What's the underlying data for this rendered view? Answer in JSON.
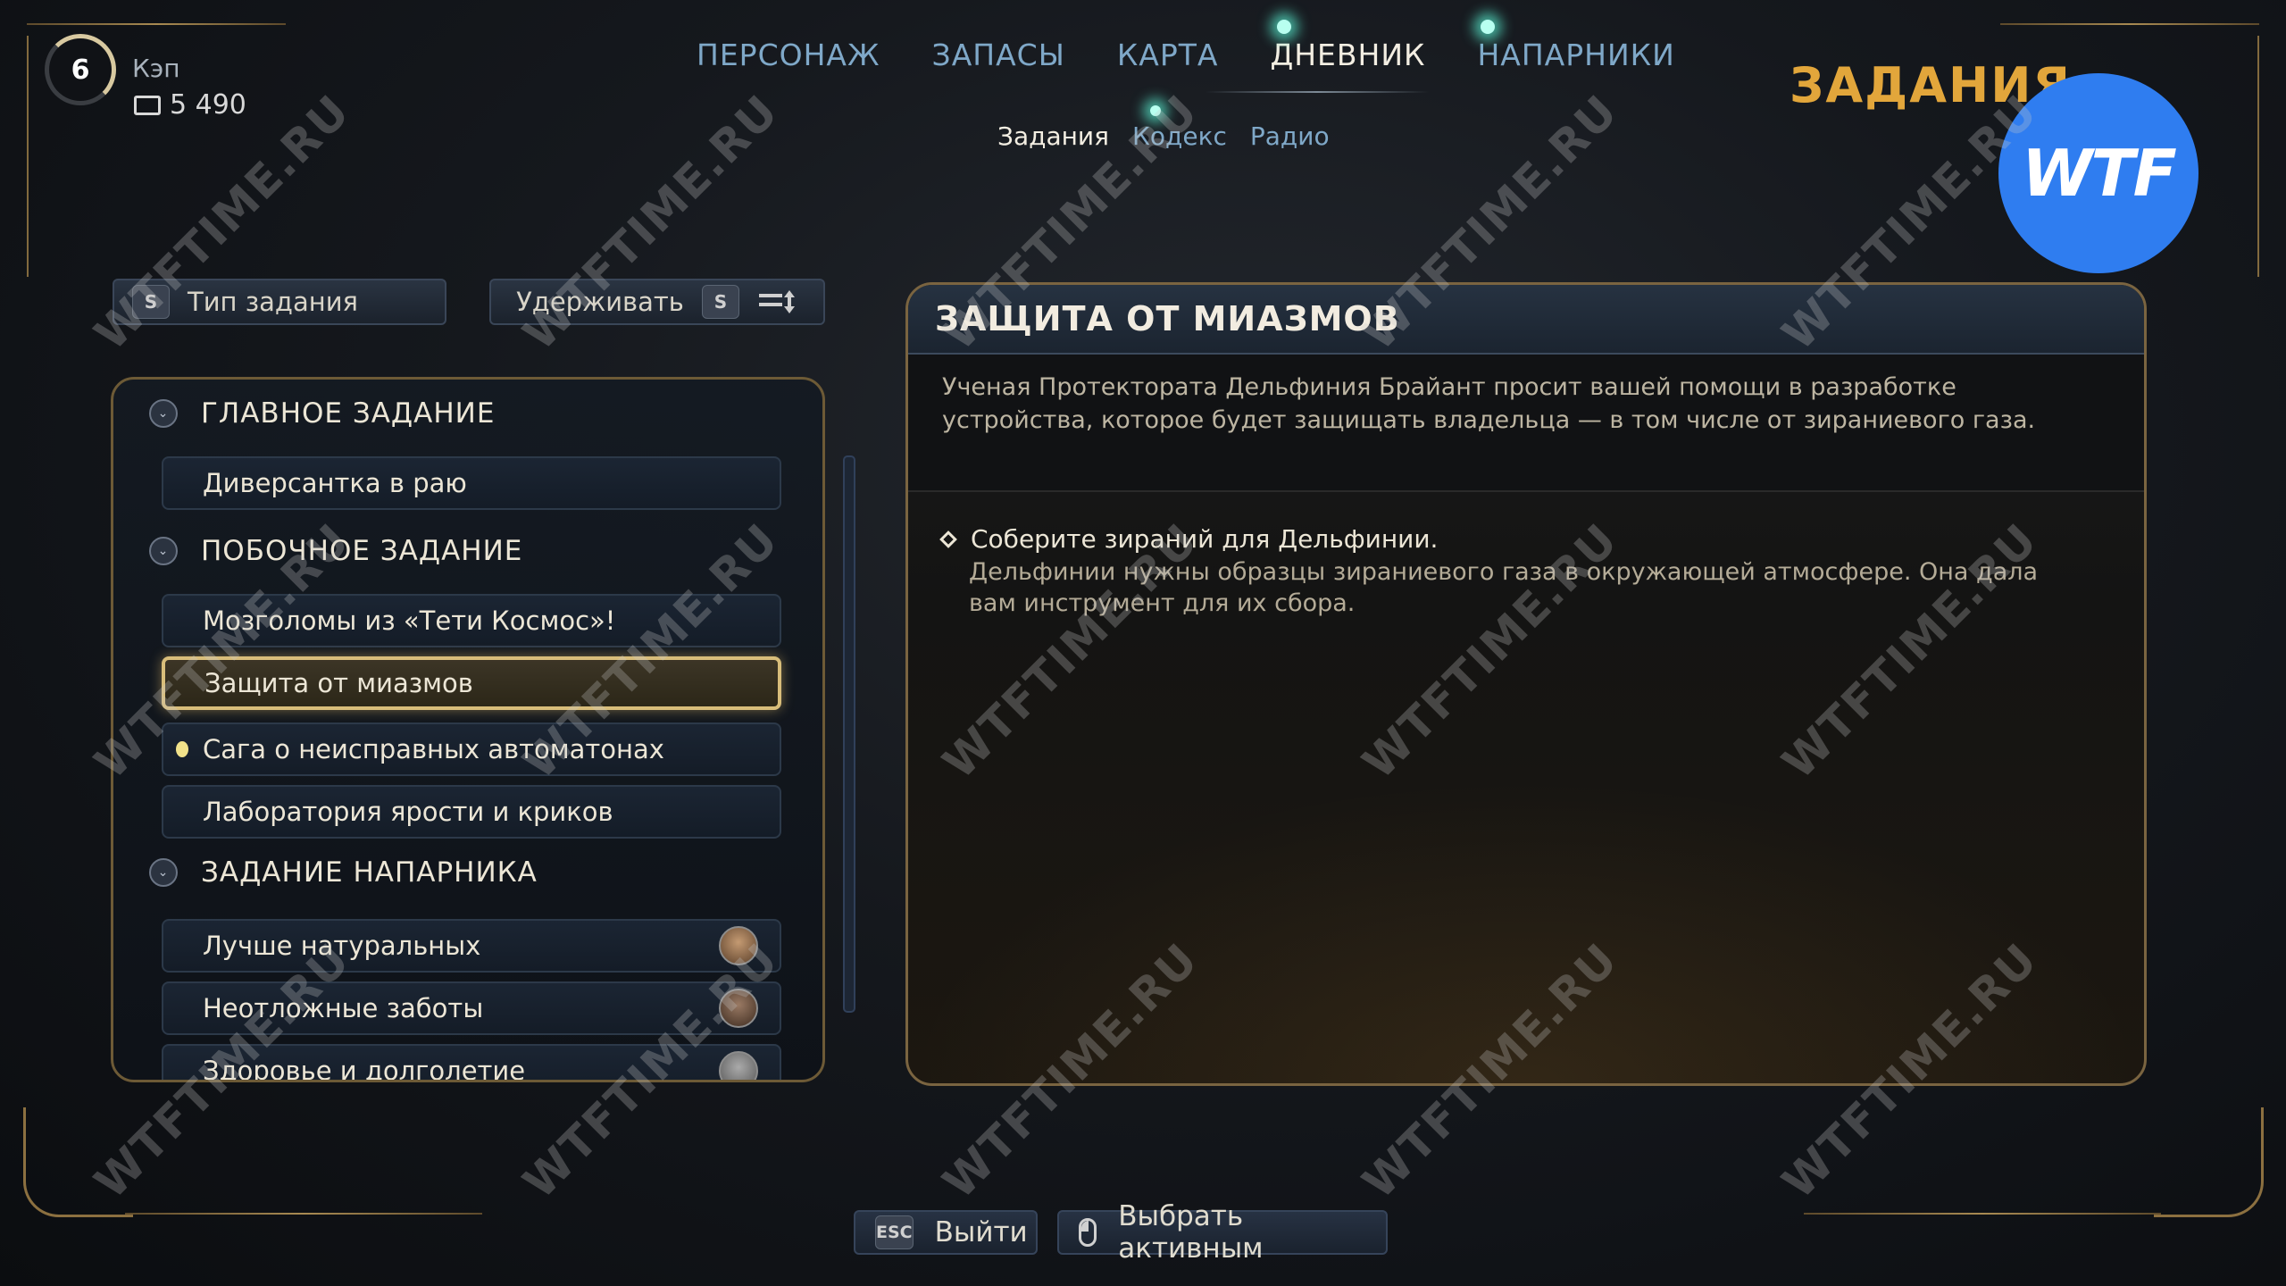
{
  "player": {
    "level": "6",
    "name": "Кэп",
    "credits": "5 490"
  },
  "nav": {
    "tabs": [
      "ПЕРСОНАЖ",
      "ЗАПАСЫ",
      "КАРТА",
      "ДНЕВНИК",
      "НАПАРНИКИ"
    ],
    "active": "ДНЕВНИК"
  },
  "subnav": {
    "tabs": [
      "Задания",
      "Кодекс",
      "Радио"
    ],
    "active": "Задания"
  },
  "section_title": "ЗАДАНИЯ",
  "badge": "WTF",
  "filters": {
    "type_key": "S",
    "type_label": "Тип задания",
    "hold_label": "Удерживать",
    "hold_key": "S"
  },
  "categories": {
    "main": "ГЛАВНОЕ ЗАДАНИЕ",
    "side": "ПОБОЧНОЕ ЗАДАНИЕ",
    "companion": "ЗАДАНИЕ НАПАРНИКА"
  },
  "quests": {
    "main_1": "Диверсантка в раю",
    "side_1": "Мозголомы из «Тети Космос»!",
    "side_2": "Защита от миазмов",
    "side_3": "Сага о неисправных автоматонах",
    "side_4": "Лаборатория ярости и криков",
    "comp_1": "Лучше натуральных",
    "comp_2": "Неотложные заботы",
    "comp_3": "Здоровье и долголетие"
  },
  "detail": {
    "title": "ЗАЩИТА ОТ МИАЗМОВ",
    "description": "Ученая Протектората Дельфиния Брайант просит вашей помощи в разработке устройства, которое будет защищать владельца — в том числе от зираниевого газа.",
    "objective": "Соберите зираний для Дельфинии.",
    "objective_desc": "Дельфинии нужны образцы зираниевого газа в окружающей атмосфере. Она дала вам инструмент для их сбора."
  },
  "bottom": {
    "esc_key": "ESC",
    "exit_label": "Выйти",
    "select_label": "Выбрать активным"
  },
  "watermark": "WTFTIME.RU",
  "colors": {
    "accent_gold": "#d8bd7a",
    "nav_blue": "#7fa8c8",
    "title_orange": "#e2a63b",
    "badge_blue": "#2f7df0"
  }
}
